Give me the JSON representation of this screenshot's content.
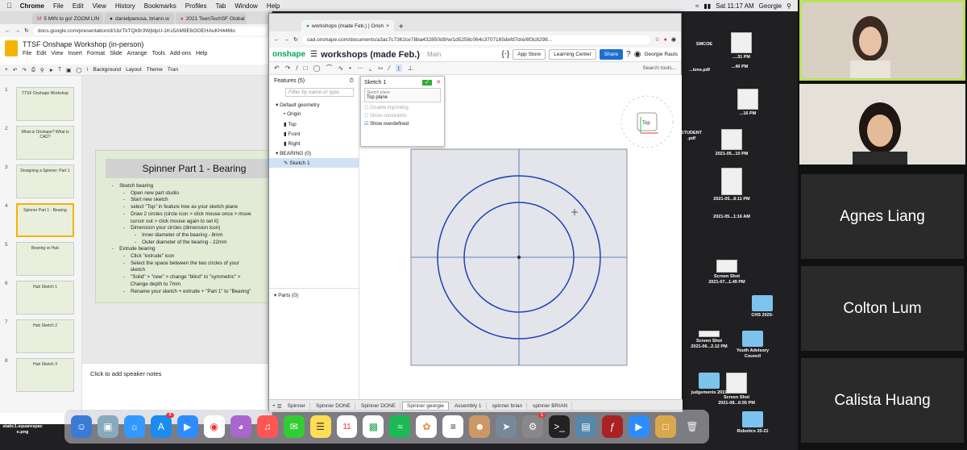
{
  "menubar": {
    "app": "Chrome",
    "items": [
      "File",
      "Edit",
      "View",
      "History",
      "Bookmarks",
      "Profiles",
      "Tab",
      "Window",
      "Help"
    ],
    "clock": "Sat 11:17 AM",
    "user": "Georgie"
  },
  "slides_window": {
    "tabs": [
      "5 MIN to go! ZOOM LIN",
      "danielpanusa, briann.w",
      "2021 TeenTechSF Global"
    ],
    "url": "docs.google.com/presentation/d/1bzTkTQk9r3WjldpU-1Ks5AM9E6OOEHAuKH44Mo",
    "doc_title": "TTSF Onshape Workshop (in-person)",
    "menu": [
      "File",
      "Edit",
      "View",
      "Insert",
      "Format",
      "Slide",
      "Arrange",
      "Tools",
      "Add-ons",
      "Help"
    ],
    "toolbar": [
      "Background",
      "Layout",
      "Theme",
      "Tran"
    ],
    "thumb_numbers": [
      "1",
      "2",
      "3",
      "4",
      "5",
      "6",
      "7",
      "8"
    ],
    "thumb_texts": [
      "TTSF Onshape Workshop",
      "What is Onshape? What is CAD?",
      "Designing a Spinner: Part 1",
      "Spinner Part 1 - Bearing",
      "Bearing vs Hub",
      "Hub Sketch 1",
      "Hub Sketch 2",
      "Hub Sketch 3"
    ],
    "slide_title": "Spinner Part 1 - Bearing",
    "slide_lines": [
      "-    Sketch bearing",
      "        -    Open new part studio",
      "        -    Start new sketch",
      "        -    select \"Top\" in feature tree as your sketch plane",
      "        -    Draw 2 circles (circle icon > click mouse once > move",
      "             cursor out > click mouse again to set it)",
      "        -    Dimension your circles (dimension icon)",
      "                -    Inner diameter of the bearing - 8mm",
      "                -    Outer diameter of the bearing - 22mm",
      "-    Extrude bearing",
      "        -    Click \"extrude\" icon",
      "        -    Select the space between the two circles of your",
      "             sketch",
      "        -    \"Solid\" > \"new\" > change \"blind\" to \"symmetric\" >",
      "             Change depth to 7mm",
      "        -    Rename your sketch + extrude + \"Part 1\" to \"Bearing\""
    ],
    "notes_placeholder": "Click to add speaker notes"
  },
  "onshape": {
    "tab_title": "workshops (made Feb.) | Onsh",
    "url": "cad.onshape.com/documents/a3ac7c7362ce78ba432850d9/w/1d5258c064c3707165defd7d/e/8f3c8298...",
    "logo": "onshape",
    "doc_title": "workshops (made Feb.)",
    "branch": "Main",
    "buttons": {
      "app_store": "App Store",
      "learning": "Learning Center",
      "share": "Share"
    },
    "user": "Georgie Rauls",
    "search_tools": "Search tools...",
    "features_header": "Features (5)",
    "filter_placeholder": "Filter by name or type",
    "tree": [
      "Default geometry",
      "Origin",
      "Top",
      "Front",
      "Right",
      "BEARING (0)",
      "Sketch 1"
    ],
    "parts": "Parts (0)",
    "sketch_dialog": {
      "title": "Sketch 1",
      "plane_label": "Sketch plane",
      "plane_value": "Top plane",
      "options": [
        "Disable imprinting",
        "Show constraints",
        "Show overdefined"
      ]
    },
    "viewcube_label": "Top",
    "bottom_tabs": [
      "Spinner",
      "Spinner DONE",
      "Spinner DONE",
      "Spinner georgie",
      "Assembly 1",
      "spinner brian",
      "spinner BRIAN"
    ],
    "active_tab": "Spinner georgie"
  },
  "desktop_icons": [
    "...ions.pdf",
    "SMCOE",
    "....31 PM",
    "...40 PM",
    "...16 PM",
    "STUDENT",
    ".pdf",
    "2021-05...10 PM",
    "2021-05...8:11 PM",
    "2021-05...1:16 AM",
    "Screen Shot",
    "2021-07...1.49 PM",
    "CHS 2020-",
    "Screen Shot",
    "2021-06...2.12 PM",
    "Youth Advisory",
    "Council",
    "judgements 2019",
    "Screen Shot",
    "2021-08...6:55 PM",
    "Robotics 20-21",
    "static1.squarespac",
    "e.png"
  ],
  "dock_badges": {
    "appstore": "4",
    "systemprefs": "1"
  },
  "dock_calendar_day": "11",
  "zoom": {
    "participants": [
      "Agnes Liang",
      "Colton Lum",
      "Calista Huang"
    ]
  }
}
